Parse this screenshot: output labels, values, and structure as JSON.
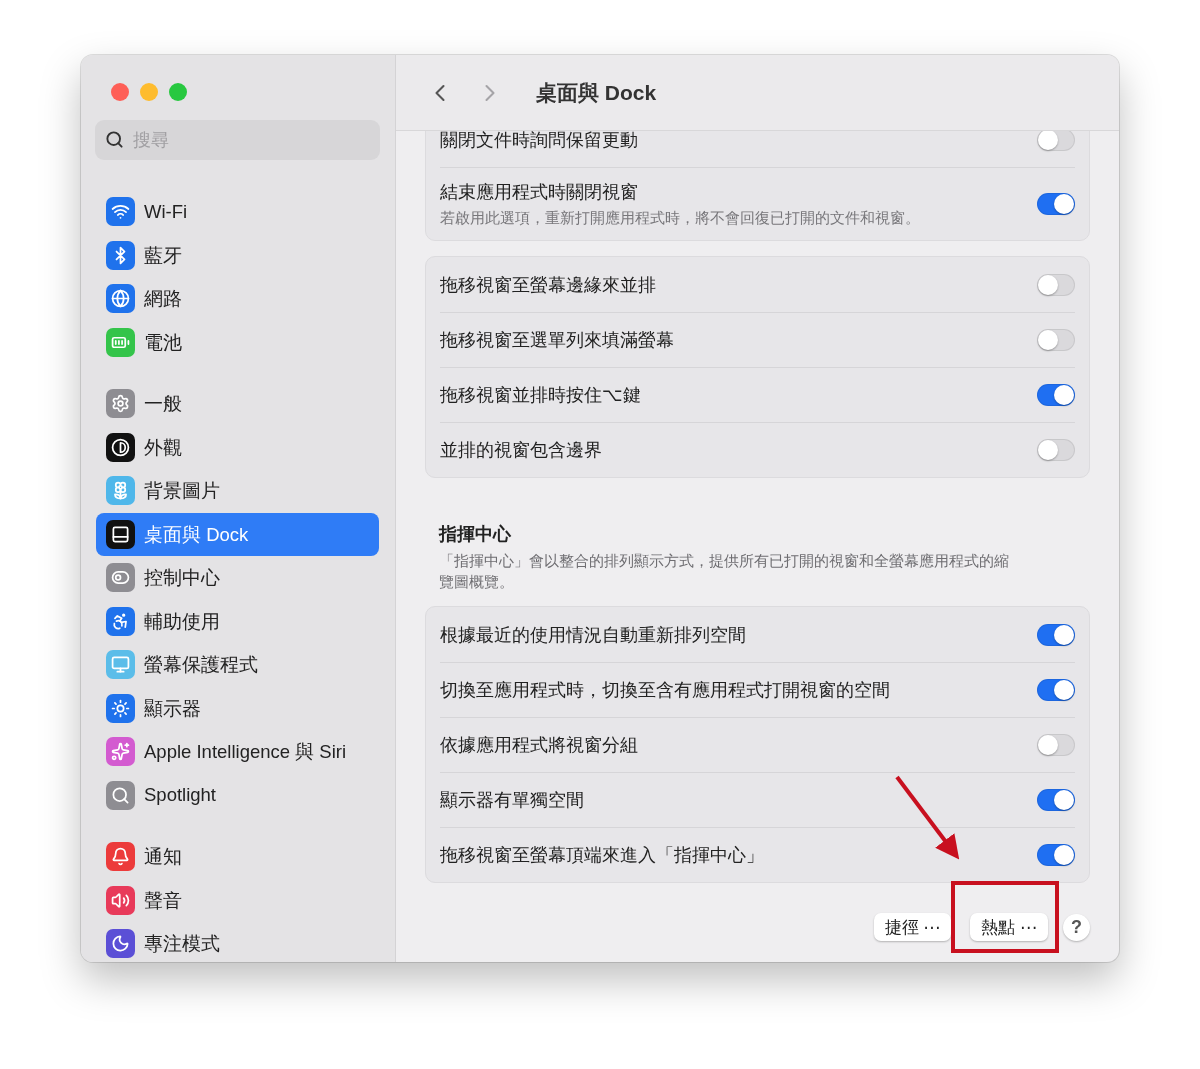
{
  "window": {
    "title": "桌面與 Dock"
  },
  "sidebar": {
    "search": {
      "placeholder": "搜尋"
    },
    "groups": [
      [
        {
          "label": "Wi-Fi",
          "selected": false
        },
        {
          "label": "藍牙",
          "selected": false
        },
        {
          "label": "網路",
          "selected": false
        },
        {
          "label": "電池",
          "selected": false
        }
      ],
      [
        {
          "label": "一般",
          "selected": false
        },
        {
          "label": "外觀",
          "selected": false
        },
        {
          "label": "背景圖片",
          "selected": false
        },
        {
          "label": "桌面與 Dock",
          "selected": true
        },
        {
          "label": "控制中心",
          "selected": false
        },
        {
          "label": "輔助使用",
          "selected": false
        },
        {
          "label": "螢幕保護程式",
          "selected": false
        },
        {
          "label": "顯示器",
          "selected": false
        },
        {
          "label": "Apple Intelligence 與 Siri",
          "selected": false
        },
        {
          "label": "Spotlight",
          "selected": false
        }
      ],
      [
        {
          "label": "通知",
          "selected": false
        },
        {
          "label": "聲音",
          "selected": false
        },
        {
          "label": "專注模式",
          "selected": false
        }
      ]
    ]
  },
  "content": {
    "groups": [
      {
        "rows": [
          {
            "label": "關閉文件時詢問保留更動",
            "on": false
          },
          {
            "label": "結束應用程式時關閉視窗",
            "description": "若啟用此選項，重新打開應用程式時，將不會回復已打開的文件和視窗。",
            "on": true
          }
        ]
      },
      {
        "rows": [
          {
            "label": "拖移視窗至螢幕邊緣來並排",
            "on": false
          },
          {
            "label": "拖移視窗至選單列來填滿螢幕",
            "on": false
          },
          {
            "label": "拖移視窗並排時按住⌥鍵",
            "on": true
          },
          {
            "label": "並排的視窗包含邊界",
            "on": false
          }
        ]
      },
      {
        "heading": "指揮中心",
        "description": "「指揮中心」會以整合的排列顯示方式，提供所有已打開的視窗和全螢幕應用程式的縮覽圖概覽。",
        "rows": [
          {
            "label": "根據最近的使用情況自動重新排列空間",
            "on": true
          },
          {
            "label": "切換至應用程式時，切換至含有應用程式打開視窗的空間",
            "on": true
          },
          {
            "label": "依據應用程式將視窗分組",
            "on": false
          },
          {
            "label": "顯示器有單獨空間",
            "on": true
          },
          {
            "label": "拖移視窗至螢幕頂端來進入「指揮中心」",
            "on": true
          }
        ]
      }
    ]
  },
  "buttons": [
    {
      "kind": "text",
      "label": "捷徑 ⋯"
    },
    {
      "kind": "text",
      "label": "熱點 ⋯"
    },
    {
      "kind": "help",
      "label": "?"
    }
  ]
}
